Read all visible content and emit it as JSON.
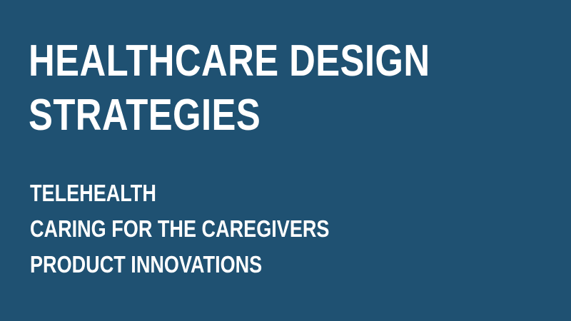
{
  "slide": {
    "title_line_1": "HEALTHCARE DESIGN",
    "title_line_2": "STRATEGIES",
    "topics": [
      "TELEHEALTH",
      "CARING FOR THE CAREGIVERS",
      "PRODUCT INNOVATIONS"
    ]
  },
  "colors": {
    "background": "#1f5172",
    "text": "#ffffff"
  }
}
